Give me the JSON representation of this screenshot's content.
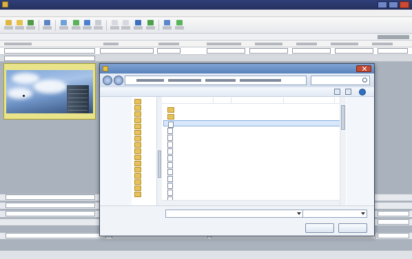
{
  "app": {
    "title": "",
    "menu": [
      "",
      "",
      "",
      "",
      "",
      ""
    ],
    "strip_label": "",
    "status": ""
  },
  "main": {
    "field_value": "",
    "preview_title": "",
    "preview_caption": "",
    "bottom_label": ""
  },
  "dialog": {
    "title": "",
    "organize_label": "",
    "new_folder_label": "",
    "search_placeholder": "",
    "nav_items": [
      "",
      "",
      "",
      "",
      "",
      "",
      "",
      "",
      "",
      "",
      "",
      "",
      "",
      "",
      "",
      ""
    ],
    "columns": [
      "",
      "",
      "",
      ""
    ],
    "files": [
      "",
      "",
      "",
      "",
      "",
      "",
      "",
      "",
      "",
      "",
      "",
      "",
      "",
      "",
      ""
    ],
    "selected_index": 2,
    "file_name_label": "",
    "file_name_value": "",
    "file_type_value": "",
    "open_label": "",
    "cancel_label": ""
  }
}
